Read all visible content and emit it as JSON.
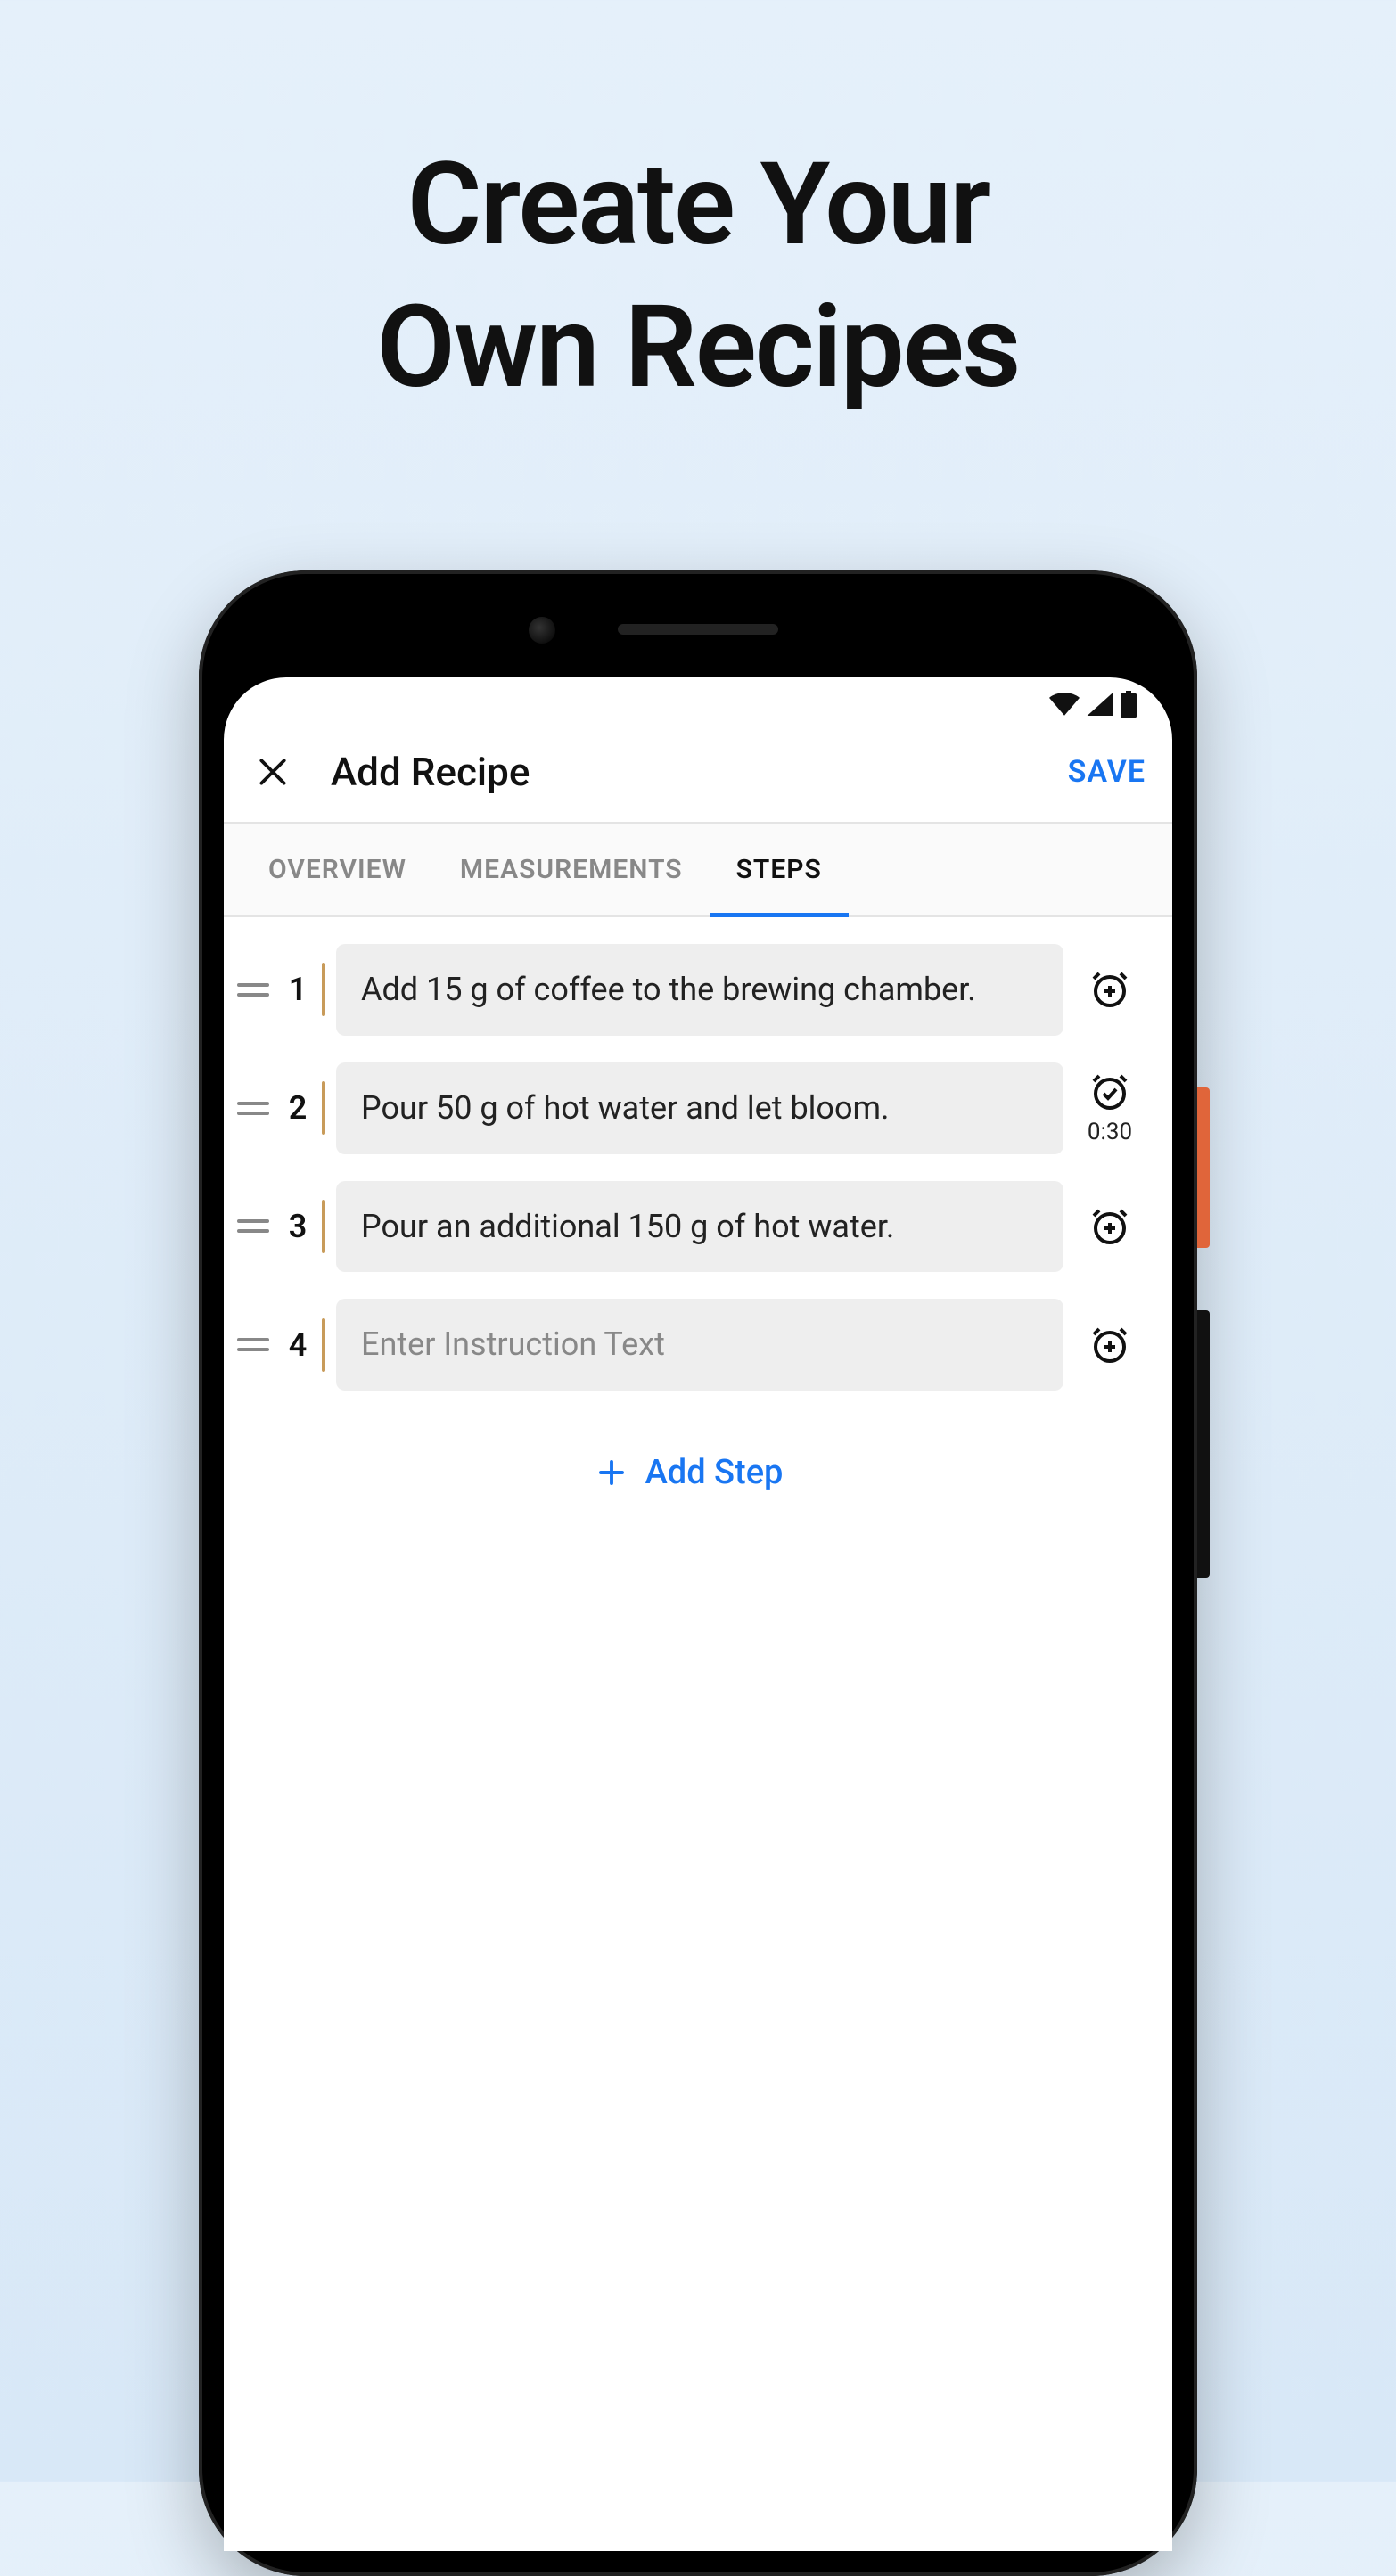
{
  "promo": {
    "line1": "Create Your",
    "line2": "Own Recipes"
  },
  "colors": {
    "accent": "#1976f2",
    "stepBg": "#eeeeee",
    "stepDivider": "#c89b5a"
  },
  "appBar": {
    "title": "Add Recipe",
    "saveLabel": "SAVE"
  },
  "tabs": [
    {
      "label": "OVERVIEW",
      "active": false
    },
    {
      "label": "MEASUREMENTS",
      "active": false
    },
    {
      "label": "STEPS",
      "active": true
    }
  ],
  "steps": [
    {
      "number": "1",
      "text": "Add 15 g of coffee to the brewing chamber.",
      "timer": null,
      "timerIcon": "add"
    },
    {
      "number": "2",
      "text": "Pour 50 g of hot water and let bloom.",
      "timer": "0:30",
      "timerIcon": "set"
    },
    {
      "number": "3",
      "text": "Pour an additional 150 g of hot water.",
      "timer": null,
      "timerIcon": "add"
    },
    {
      "number": "4",
      "text": "",
      "placeholder": "Enter Instruction Text",
      "timer": null,
      "timerIcon": "add"
    }
  ],
  "addStepLabel": "Add Step"
}
